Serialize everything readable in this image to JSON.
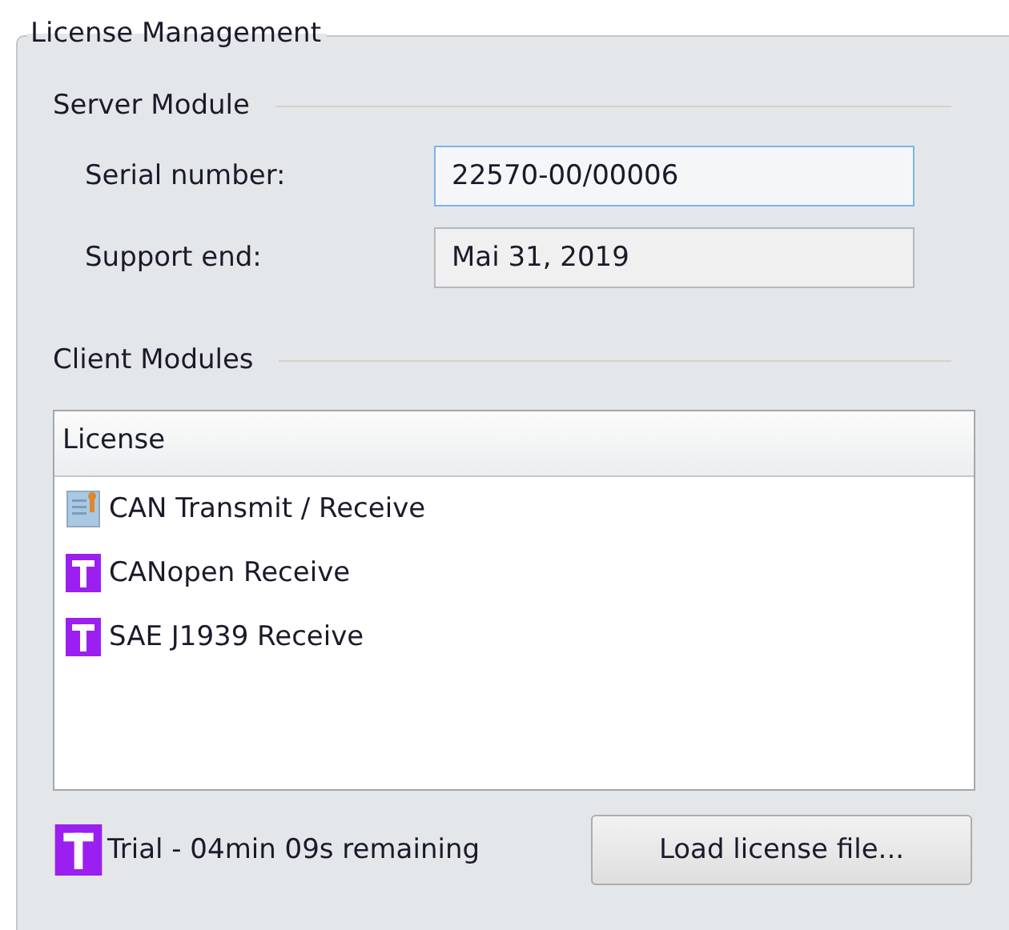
{
  "group": {
    "title": "License Management"
  },
  "server_module": {
    "title": "Server Module",
    "fields": [
      {
        "label": "Serial number:",
        "value": "22570-00/00006",
        "focused": true
      },
      {
        "label": "Support end:",
        "value": "Mai 31, 2019",
        "focused": false
      }
    ]
  },
  "client_modules": {
    "title": "Client Modules",
    "table": {
      "columns": [
        "License"
      ],
      "rows": [
        {
          "kind": "full",
          "name": "CAN Transmit / Receive"
        },
        {
          "kind": "trial",
          "name": "CANopen Receive"
        },
        {
          "kind": "trial",
          "name": "SAE J1939 Receive"
        }
      ]
    }
  },
  "status": {
    "kind": "trial",
    "text": "Trial - 04min 09s remaining"
  },
  "buttons": [
    "Load license file..."
  ]
}
